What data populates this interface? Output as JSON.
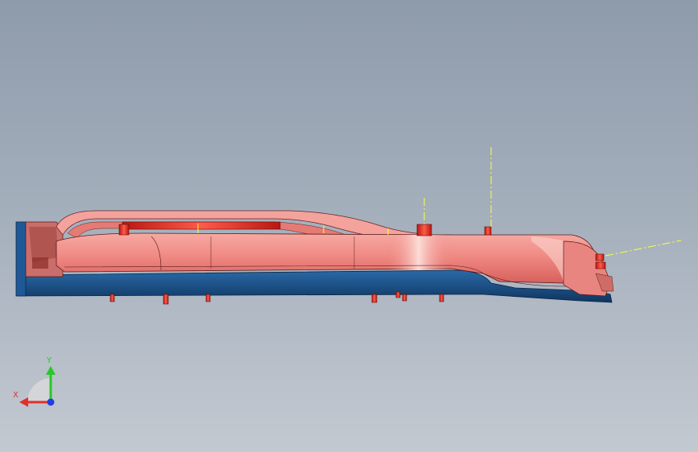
{
  "viewport": {
    "background_top": "#8e9bab",
    "background_bottom": "#c3c9d1"
  },
  "part": {
    "body_color": "#f08a84",
    "body_highlight": "#fbd3cf",
    "base_color": "#1c4f86",
    "pin_color": "#e0241c",
    "edge_color": "#5a1a1a",
    "centerline_color": "#ffff33"
  },
  "triad": {
    "x_label": "X",
    "y_label": "Y",
    "x_color": "#e0302a",
    "y_color": "#28c828",
    "z_color": "#1f3fe0"
  }
}
